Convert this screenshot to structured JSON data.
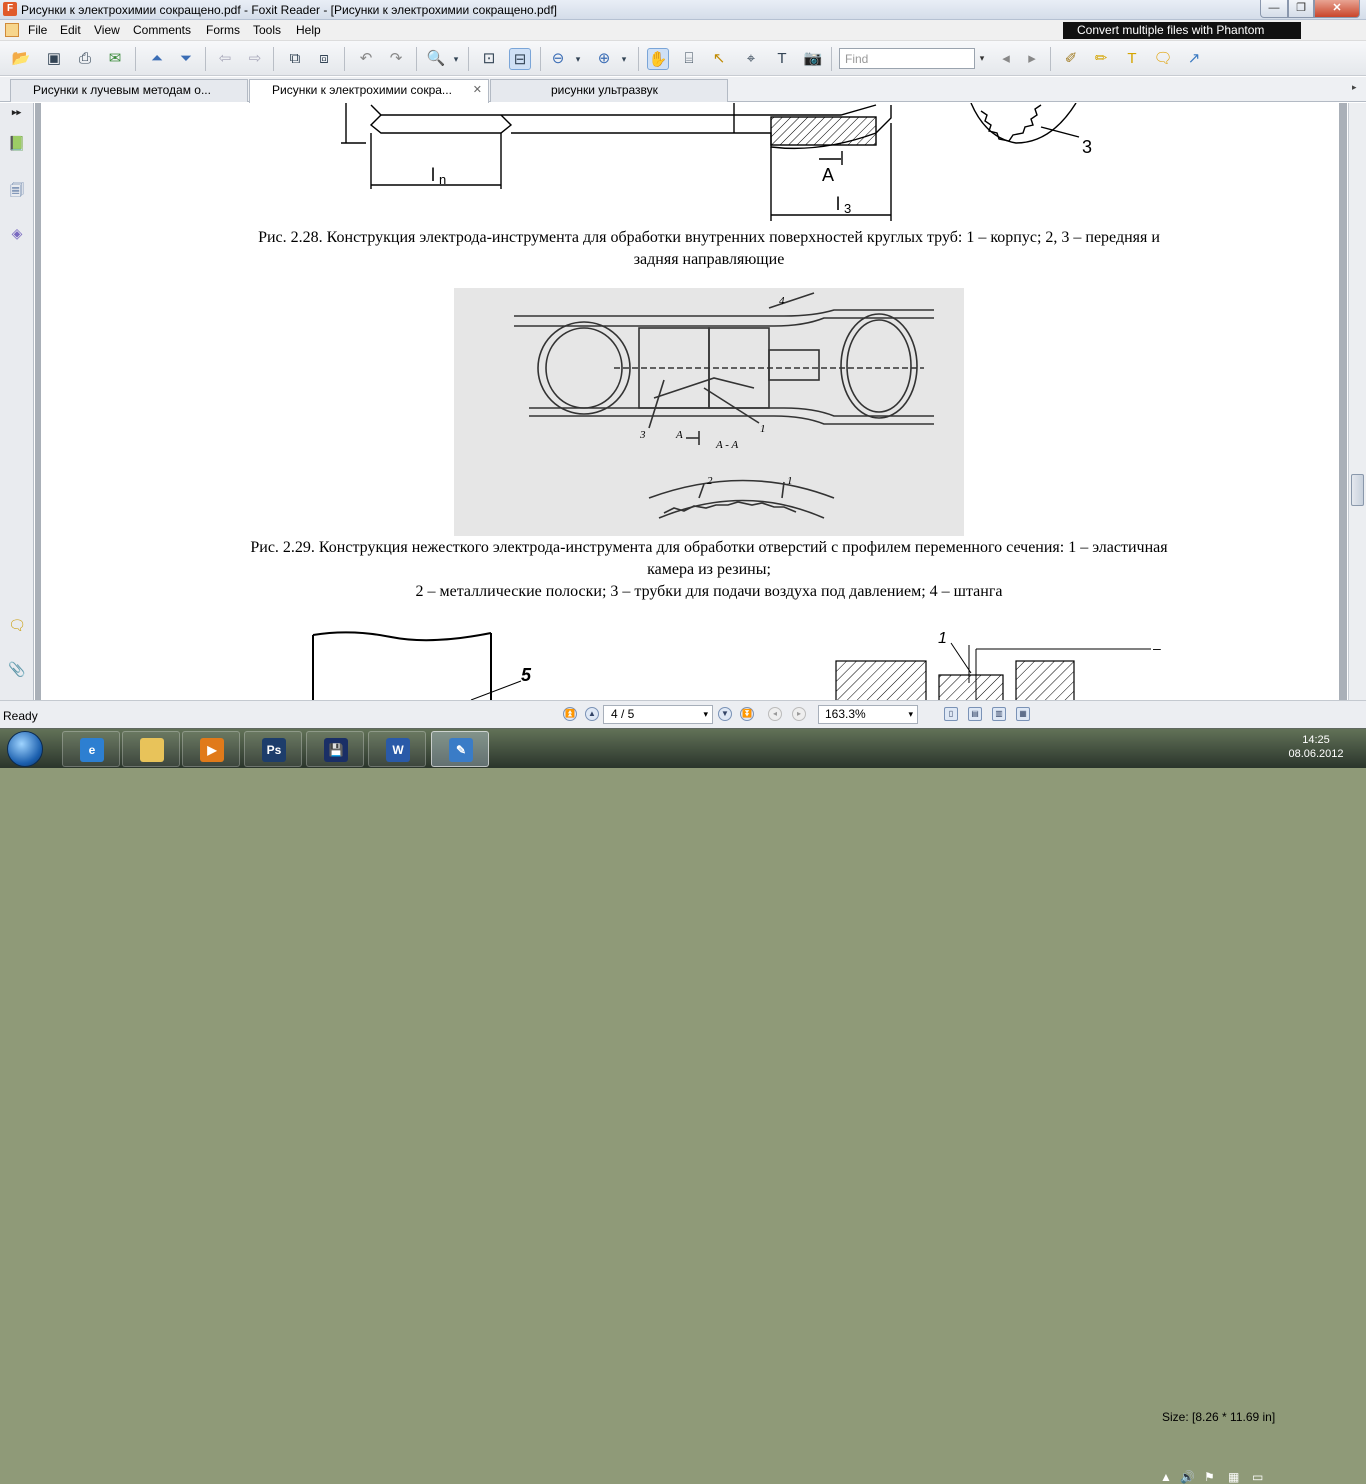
{
  "window": {
    "title": "Рисунки к электрохимии сокращено.pdf - Foxit Reader - [Рисунки к электрохимии сокращено.pdf]",
    "min_glyph": "—",
    "max_glyph": "❐",
    "close_glyph": "✕"
  },
  "menu": {
    "items": [
      "File",
      "Edit",
      "View",
      "Comments",
      "Forms",
      "Tools",
      "Help"
    ],
    "banner": "Convert multiple files with Phantom"
  },
  "toolbar": {
    "find_placeholder": "Find",
    "find_dropdown_glyph": "▾"
  },
  "tabs": [
    {
      "label": "Рисунки к лучевым методам о..."
    },
    {
      "label": "Рисунки к электрохимии сокра...",
      "close": "✕"
    },
    {
      "label": "рисунки ультразвук"
    }
  ],
  "tab_scroll_glyph": "▸",
  "left_panel": {
    "collapse_glyph": "▸▸"
  },
  "document": {
    "fig228_labels": {
      "ln": "l",
      "ln_sub": "n",
      "a": "A",
      "l3": "l",
      "l3_sub": "3",
      "num3": "3"
    },
    "caption_228_line1": "Рис. 2.28. Конструкция электрода-инструмента для обработки внутренних поверхностей круглых труб: 1 – корпус; 2, 3 – передняя и",
    "caption_228_line2": "задняя направляющие",
    "fig229_labels": {
      "n4": "4",
      "n3": "3",
      "n1": "1",
      "a": "A",
      "aa": "A - A",
      "n2": "2",
      "n1b": "1"
    },
    "caption_229_line1": "Рис. 2.29. Конструкция нежесткого электрода-инструмента для обработки отверстий с профилем переменного сечения: 1 – эластичная",
    "caption_229_line2": "камера из резины;",
    "caption_229_line3": "2 – металлические полоски; 3 – трубки для подачи воздуха под давлением; 4 – штанга",
    "fig230_labels": {
      "n5": "5",
      "n1": "1",
      "dash": "–"
    }
  },
  "status": {
    "ready": "Ready",
    "page_value": "4 / 5",
    "zoom_value": "163.3%",
    "size": "Size: [8.26 * 11.69 in]",
    "dropdown_glyph": "▾"
  },
  "taskbar": {
    "apps": [
      {
        "name": "ie",
        "label": "e",
        "color": "#2d7fd1"
      },
      {
        "name": "explorer",
        "label": "",
        "color": "#e8c35a"
      },
      {
        "name": "media",
        "label": "▶",
        "color": "#e07a1a"
      },
      {
        "name": "photoshop",
        "label": "Ps",
        "color": "#1d3d6b"
      },
      {
        "name": "save",
        "label": "💾",
        "color": "#1a2f66"
      },
      {
        "name": "word",
        "label": "W",
        "color": "#2a5aa8"
      },
      {
        "name": "foxit",
        "label": "✎",
        "color": "#3a7cc7"
      }
    ],
    "time": "14:25",
    "date": "08.06.2012",
    "tray_up_glyph": "▲"
  },
  "colors": {
    "title_bg": "#d4dde9",
    "close_red": "#c9452a",
    "taskbar": "#2b3a2e"
  }
}
